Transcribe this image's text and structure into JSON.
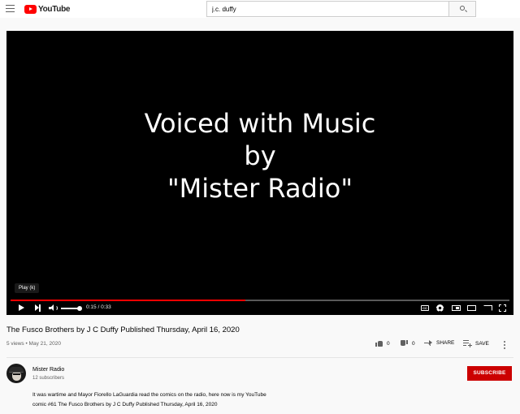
{
  "header": {
    "logo_text": "YouTube",
    "search_value": "j.c. duffy",
    "brand_color": "#ff0000"
  },
  "player": {
    "title_lines": [
      "Voiced with Music",
      "by",
      "\"Mister Radio\""
    ],
    "tooltip": "Play (k)",
    "time": "0:15 / 0:33",
    "progress": 0.47,
    "volume": 0.85,
    "cc_label": "CC"
  },
  "video": {
    "title": "The Fusco Brothers by J C Duffy Published Thursday, April 16, 2020",
    "meta": "5 views • May 21, 2020",
    "likes": "0",
    "dislikes": "0",
    "share_label": "SHARE",
    "save_label": "SAVE"
  },
  "channel": {
    "name": "Mister Radio",
    "subscribers": "12 subscribers",
    "subscribe_label": "SUBSCRIBE"
  },
  "description": {
    "line1": "It was wartime and Mayor Fiorello LaGuardia read the comics on the radio, here now is my YouTube",
    "line2": "comic #61 The Fusco Brothers by J C  Duffy Published  Thursday, April 16, 2020"
  }
}
